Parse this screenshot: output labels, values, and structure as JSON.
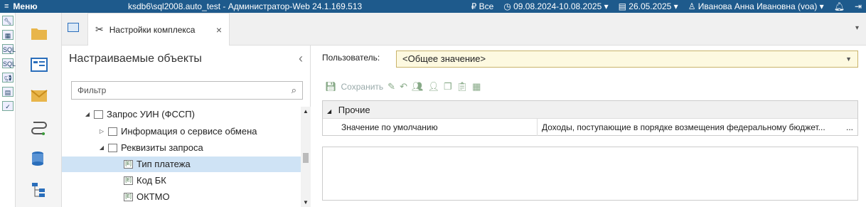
{
  "topbar": {
    "menu_label": "Меню",
    "title": "ksdb6\\sql2008.auto_test - Администратор-Web 24.1.169.513",
    "filter_all": "₽ Все",
    "period": "09.08.2024-10.08.2025",
    "date": "26.05.2025",
    "user": "Иванова Анна Ивановна (voa)"
  },
  "tab": {
    "label": "Настройки комплекса",
    "close": "×"
  },
  "left_panel": {
    "title": "Настраиваемые объекты",
    "filter_placeholder": "Фильтр",
    "tree": [
      {
        "label": "Запрос УИН (ФССП)",
        "expanded": true
      },
      {
        "label": "Информация о сервисе обмена",
        "expanded": false
      },
      {
        "label": "Реквизиты запроса",
        "expanded": true
      },
      {
        "label": "Тип платежа",
        "selected": true
      },
      {
        "label": "Код БК"
      },
      {
        "label": "ОКТМО"
      }
    ]
  },
  "right_panel": {
    "user_label": "Пользователь:",
    "user_value": "<Общее значение>",
    "save_label": "Сохранить",
    "group_label": "Прочие",
    "row_name": "Значение по умолчанию",
    "row_value": "Доходы, поступающие в порядке возмещения федеральному бюджет...",
    "row_button": "..."
  }
}
